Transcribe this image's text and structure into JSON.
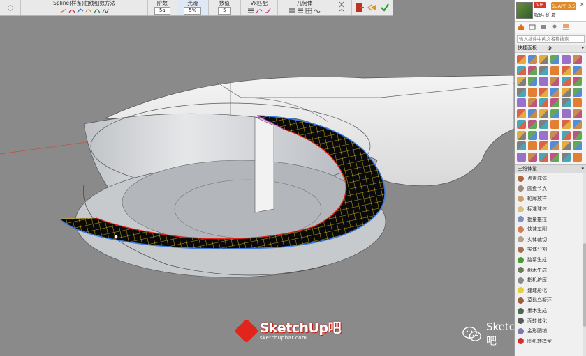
{
  "toolbar": {
    "spline_label": "Spline(样条)曲线细数方法",
    "degree_label": "阶数",
    "degree_value": "5a",
    "smooth_label": "光滑",
    "smooth_value": "5%",
    "count_label": "数值",
    "count_value": "5",
    "vx_label": "Vx匹配",
    "geom_label": "几何体"
  },
  "panel": {
    "vip_badge": "VIP",
    "user_name": "解码 矿夏",
    "version_badge": "SUAPP 3.5",
    "close": "×",
    "search_placeholder": "输入插件中英文名称搜索",
    "quick_title": "快捷面板",
    "section_title": "三维体量",
    "commands": [
      "点置成体",
      "圆盘节点",
      "轮廓放样",
      "标准球体",
      "批量推拉",
      "快速车削",
      "实体裁切",
      "实体分割",
      "路幕生成",
      "树木生成",
      "指机挤压",
      "建球形化",
      "莫比乌斯环",
      "墨木生成",
      "面转体化",
      "金形圆铺",
      "图纸转模型"
    ]
  },
  "watermark": {
    "logo_title": "SketchUp吧",
    "logo_sub": "sketchupbar.com",
    "wechat_text": "SketchUp吧"
  },
  "colors": {
    "viewport_bg": "#8a8a8a",
    "accent_red": "#e1241c",
    "grid_yellow": "#f2d21e",
    "edge_blue": "#3d7be0"
  }
}
